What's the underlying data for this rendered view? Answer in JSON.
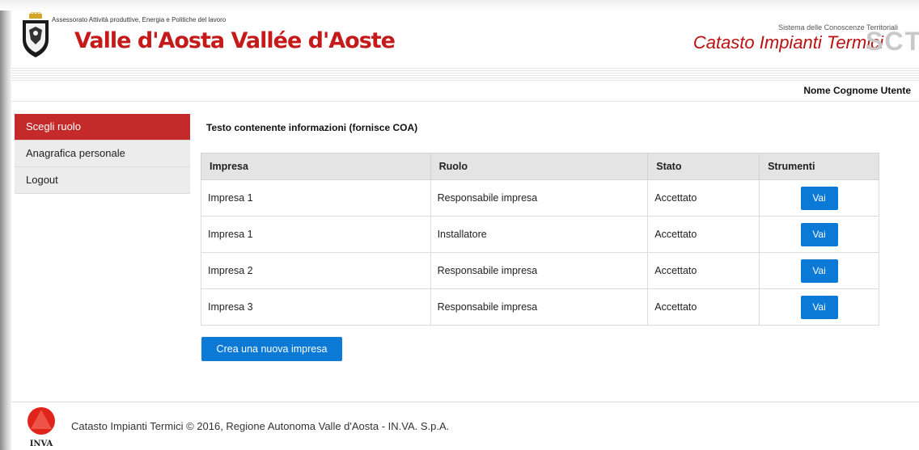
{
  "header": {
    "assessorato": "Assessorato Attività produttive, Energia e Politiche del lavoro",
    "region_name": "Valle d'Aosta Vallée d'Aoste",
    "system_subtitle": "Sistema delle Conoscenze Territoriali",
    "system_title": "Catasto Impianti Termici",
    "system_logo": "SCT"
  },
  "user": {
    "name": "Nome Cognome Utente"
  },
  "sidebar": {
    "items": [
      {
        "label": "Scegli ruolo",
        "active": true
      },
      {
        "label": "Anagrafica personale",
        "active": false
      },
      {
        "label": "Logout",
        "active": false
      }
    ]
  },
  "main": {
    "info_text": "Testo contenente informazioni (fornisce COA)",
    "table": {
      "headers": [
        "Impresa",
        "Ruolo",
        "Stato",
        "Strumenti"
      ],
      "rows": [
        {
          "impresa": "Impresa 1",
          "ruolo": "Responsabile impresa",
          "stato": "Accettato",
          "action": "Vai"
        },
        {
          "impresa": "Impresa 1",
          "ruolo": "Installatore",
          "stato": "Accettato",
          "action": "Vai"
        },
        {
          "impresa": "Impresa 2",
          "ruolo": "Responsabile impresa",
          "stato": "Accettato",
          "action": "Vai"
        },
        {
          "impresa": "Impresa 3",
          "ruolo": "Responsabile impresa",
          "stato": "Accettato",
          "action": "Vai"
        }
      ]
    },
    "create_button": "Crea una nuova impresa"
  },
  "footer": {
    "logo_label": "INVA",
    "text": "Catasto Impianti Termici © 2016, Regione Autonoma Valle d'Aosta - IN.VA. S.p.A."
  },
  "colors": {
    "brand_red": "#c41a1a",
    "active_menu": "#c42a2a",
    "button_blue": "#0b79d6"
  }
}
